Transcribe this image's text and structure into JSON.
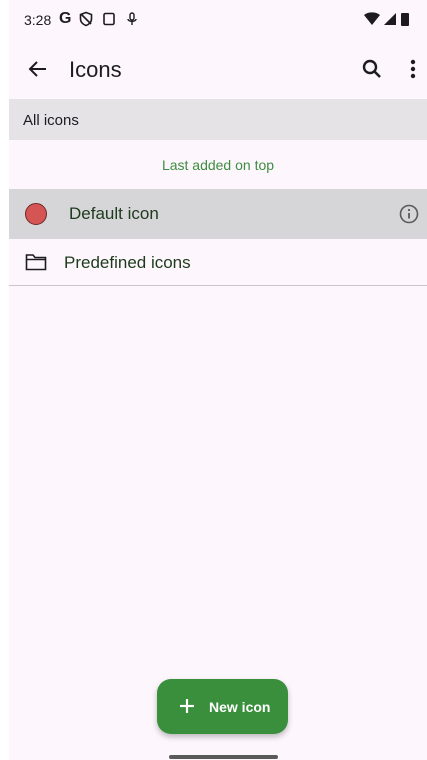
{
  "status_bar": {
    "time": "3:28",
    "g_label": "G"
  },
  "app_bar": {
    "title": "Icons",
    "back_icon": "arrow-left-icon",
    "search_icon": "search-icon",
    "menu_icon": "more-vert-icon"
  },
  "section": {
    "header": "All icons",
    "sort_label": "Last added on top"
  },
  "list": {
    "items": [
      {
        "label": "Default icon",
        "icon": "red-circle-icon",
        "trailing_icon": "info-icon",
        "selected": true
      },
      {
        "label": "Predefined icons",
        "icon": "folder-icon"
      }
    ]
  },
  "fab": {
    "label": "New icon",
    "icon": "plus-icon"
  },
  "colors": {
    "accent": "#3a8f3c",
    "selected_row": "#d6d5d8",
    "header_bg": "#e5e3e6",
    "default_icon": "#d55454"
  }
}
